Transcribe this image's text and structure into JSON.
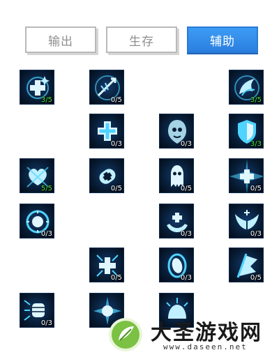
{
  "tabs": [
    {
      "label": "输出",
      "active": false
    },
    {
      "label": "生存",
      "active": false
    },
    {
      "label": "辅助",
      "active": true
    }
  ],
  "skills": [
    {
      "icon": "heal-plus-icon",
      "level": "3/5"
    },
    {
      "icon": "arrow-burst-icon",
      "level": "0/5"
    },
    {
      "icon": "wing-flame-icon",
      "level": "3/5"
    },
    {
      "icon": "medkit-cross-icon",
      "level": "0/3"
    },
    {
      "icon": "spirit-shield-icon",
      "level": "0/3"
    },
    {
      "icon": "guard-shield-icon",
      "level": "3/3"
    },
    {
      "icon": "heart-crest-icon",
      "level": "5/5"
    },
    {
      "icon": "heal-capsule-icon",
      "level": "0/5"
    },
    {
      "icon": "ghost-ward-icon",
      "level": "0/5"
    },
    {
      "icon": "radiant-cross-icon",
      "level": "0/5"
    },
    {
      "icon": "sun-orb-icon",
      "level": "0/3"
    },
    {
      "icon": "helping-hands-icon",
      "level": "0/3"
    },
    {
      "icon": "angel-wings-icon",
      "level": "0/3"
    },
    {
      "icon": "spark-cross-icon",
      "level": "0/5"
    },
    {
      "icon": "mirror-shield-icon",
      "level": "0/3"
    },
    {
      "icon": "flag-banner-icon",
      "level": "0/5"
    },
    {
      "icon": "fist-strike-icon",
      "level": "0/3"
    },
    {
      "icon": "thorn-burst-icon",
      "level": ""
    },
    {
      "icon": "radiant-dome-icon",
      "level": ""
    }
  ],
  "watermark": {
    "title": "大圣游戏网",
    "url": "www.daseen.net"
  },
  "colors": {
    "accent": "#2b7fe0",
    "glow": "#4fd4ff",
    "maxed": "#4ce23a"
  }
}
